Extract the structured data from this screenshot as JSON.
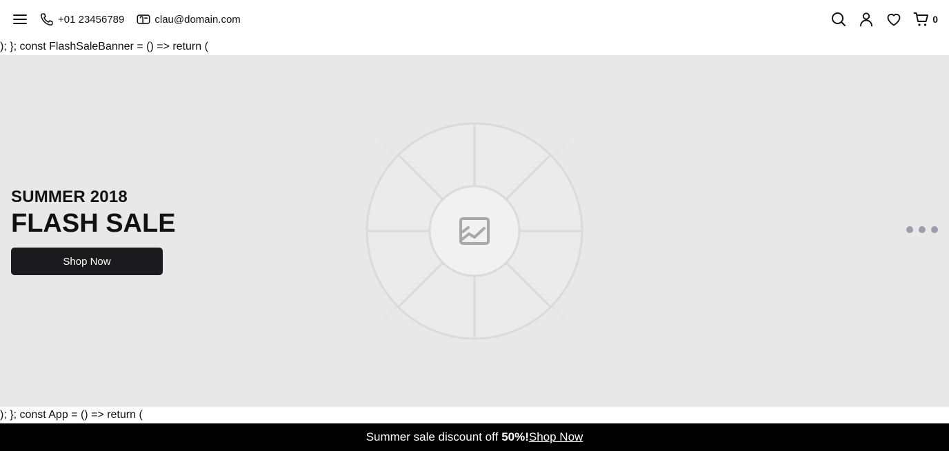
{
  "header": {
    "phone": "+01 23456789",
    "email": "clau@domain.com",
    "cart_count": "0",
    "icons": [
      "menu-icon",
      "phone-icon",
      "mail-icon",
      "search-icon",
      "user-icon",
      "heart-icon",
      "cart-icon"
    ]
  },
  "stray_text": {
    "line1": "); }; const FlashSaleBanner = () => return (",
    "line2": "); }; const App = () => return ("
  },
  "banner": {
    "subtitle": "SUMMER 2018",
    "title": "FLASH SALE",
    "cta_label": "Shop Now",
    "image_icon": "image-placeholder-icon",
    "slide_dots": 3
  },
  "announcement": {
    "text": "Summer sale discount off",
    "highlight": "50%!",
    "link": "Shop Now"
  },
  "colors": {
    "banner_bg": "#e8e8e8",
    "cta_bg": "#1b1b1e",
    "announce_bg": "#000000",
    "dot": "#9aa0ab"
  }
}
